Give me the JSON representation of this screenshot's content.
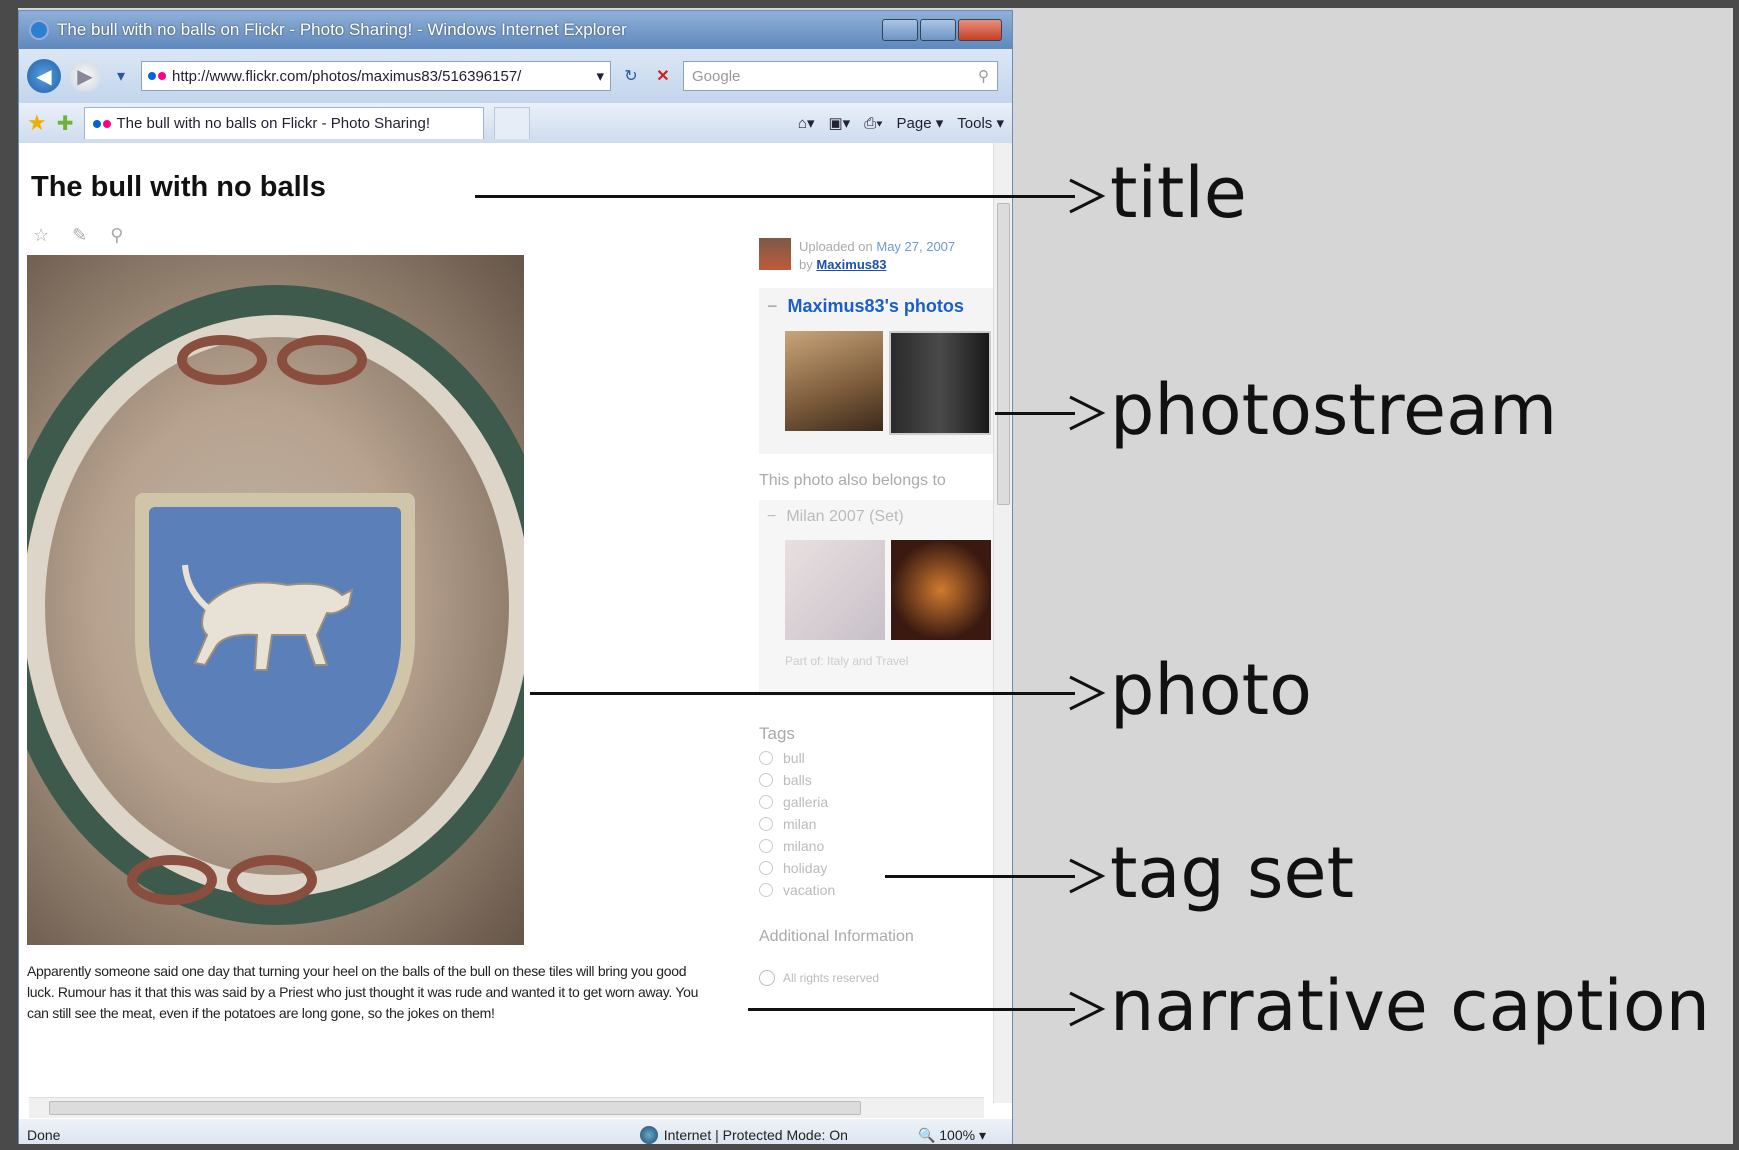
{
  "window": {
    "title": "The bull with no balls on Flickr - Photo Sharing! - Windows Internet Explorer",
    "url": "http://www.flickr.com/photos/maximus83/516396157/",
    "search_placeholder": "Google",
    "tab_label": "The bull with no balls on Flickr - Photo Sharing!",
    "page_menu": "Page",
    "tools_menu": "Tools"
  },
  "page": {
    "title": "The bull with no balls",
    "uploaded_prefix": "Uploaded on",
    "uploaded_date": "May 27, 2007",
    "by_prefix": "by",
    "username": "Maximus83",
    "photostream_title": "Maximus83's photos",
    "also_belongs": "This photo also belongs to",
    "set_title": "Milan 2007 (Set)",
    "part_of": "Part of: Italy and Travel",
    "tags_heading": "Tags",
    "tags": [
      "bull",
      "balls",
      "galleria",
      "milan",
      "milano",
      "holiday",
      "vacation"
    ],
    "additional_info": "Additional Information",
    "rights": "All rights reserved",
    "caption": "Apparently someone said one day that turning your heel on the balls of the bull on these tiles will bring you good luck. Rumour has it that this was said by a Priest who just thought it was rude and wanted it to get worn away. You can still see the meat, even if the potatoes are long gone, so the jokes on them!"
  },
  "status": {
    "left": "Done",
    "zone": "Internet | Protected Mode: On",
    "zoom": "100%"
  },
  "annotations": {
    "title": "title",
    "photostream": "photostream",
    "photo": "photo",
    "tag_set": "tag set",
    "narrative_caption": "narrative caption"
  },
  "colors": {
    "background": "#d6d6d6",
    "flickr_blue": "#0063dc",
    "flickr_pink": "#ff0084",
    "link_blue": "#1a5fc8"
  }
}
